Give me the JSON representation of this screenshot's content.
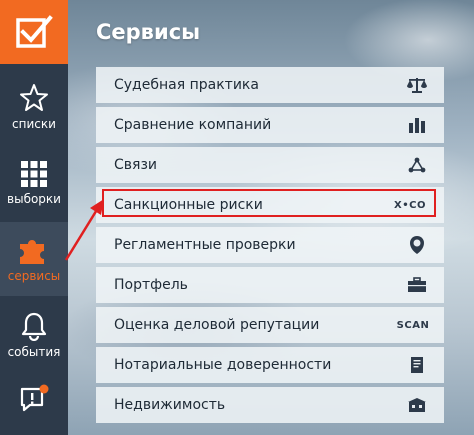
{
  "sidebar": {
    "items": [
      {
        "key": "lists",
        "label": "списки",
        "icon": "star-icon"
      },
      {
        "key": "selections",
        "label": "выборки",
        "icon": "grid-icon"
      },
      {
        "key": "services",
        "label": "сервисы",
        "icon": "puzzle-icon",
        "active": true
      },
      {
        "key": "events",
        "label": "события",
        "icon": "bell-icon"
      },
      {
        "key": "feedback",
        "label": "",
        "icon": "alert-chat-icon"
      }
    ]
  },
  "header": {
    "title": "Сервисы"
  },
  "services": [
    {
      "label": "Судебная практика",
      "icon": "scales-icon"
    },
    {
      "label": "Сравнение компаний",
      "icon": "bar-chart-icon"
    },
    {
      "label": "Связи",
      "icon": "network-icon"
    },
    {
      "label": "Санкционные риски",
      "icon": "sanctions-icon",
      "icon_text": "X•CO",
      "highlighted": true
    },
    {
      "label": "Регламентные проверки",
      "icon": "shield-check-icon"
    },
    {
      "label": "Портфель",
      "icon": "briefcase-icon"
    },
    {
      "label": "Оценка деловой репутации",
      "icon": "scan-icon",
      "icon_text": "SCAN"
    },
    {
      "label": "Нотариальные доверенности",
      "icon": "document-icon"
    },
    {
      "label": "Недвижимость",
      "icon": "building-icon"
    }
  ],
  "colors": {
    "accent": "#f26a21",
    "sidebar": "#2d3a4a",
    "highlight": "#e02020"
  }
}
